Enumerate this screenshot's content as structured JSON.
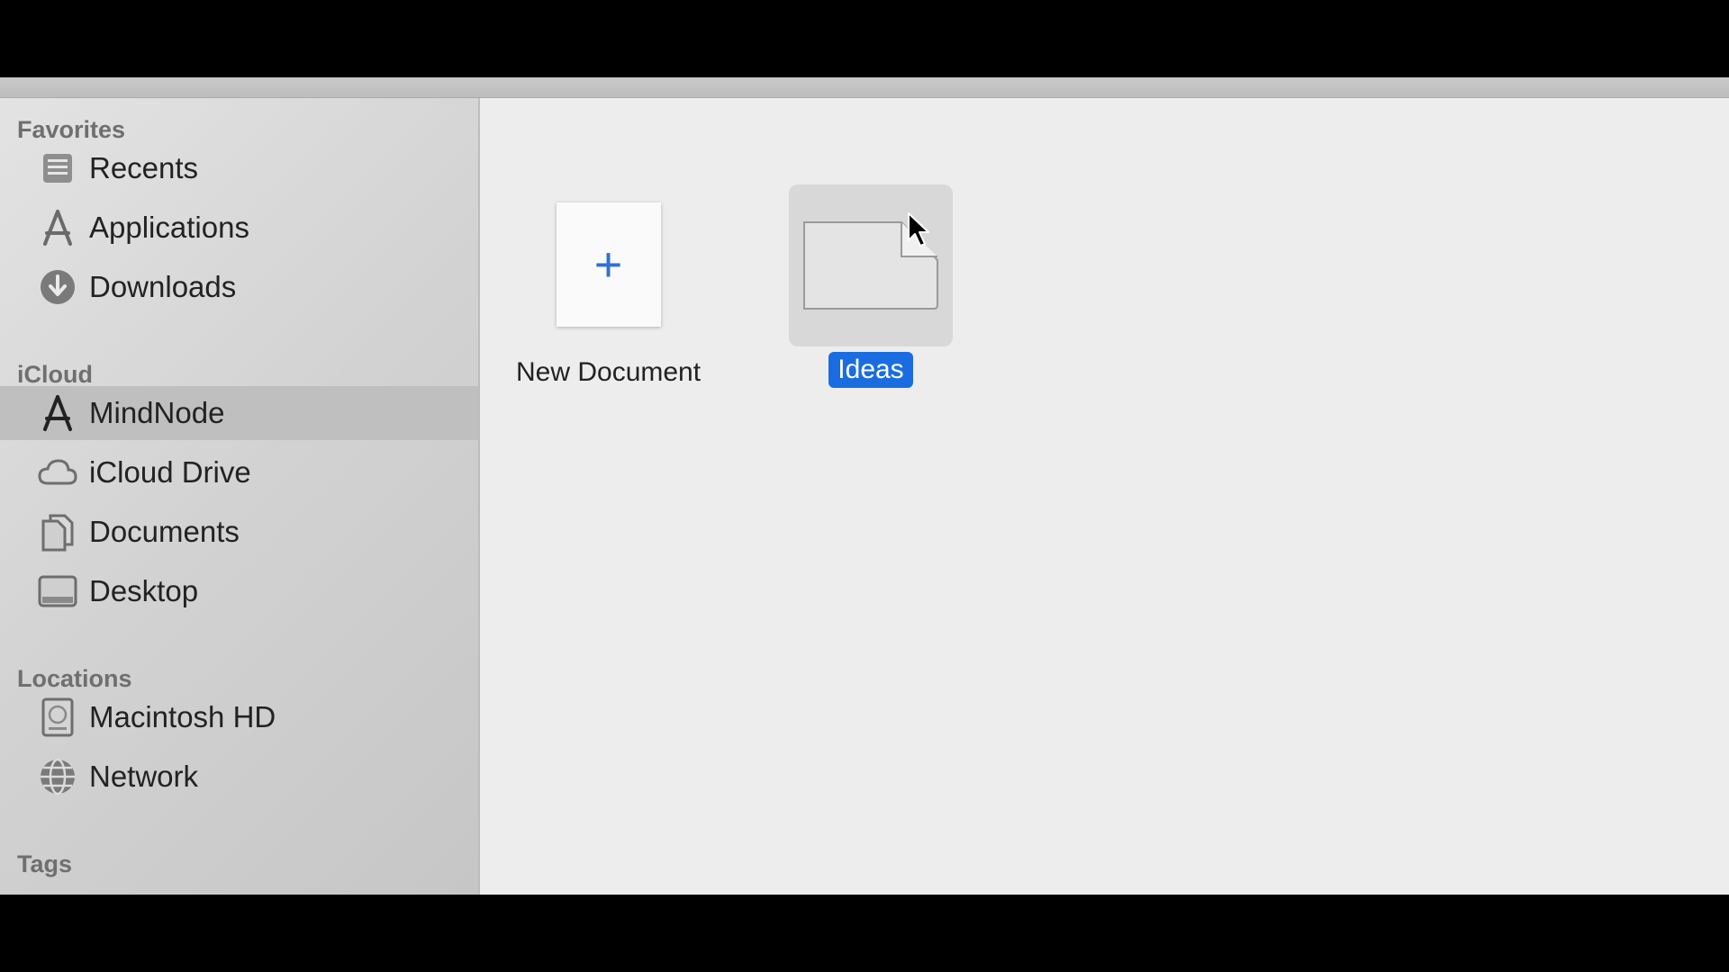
{
  "sidebar": {
    "sections": {
      "favorites": "Favorites",
      "icloud": "iCloud",
      "locations": "Locations",
      "tags": "Tags"
    },
    "items": [
      {
        "label": "Recents",
        "icon": "recents-icon"
      },
      {
        "label": "Applications",
        "icon": "applications-icon"
      },
      {
        "label": "Downloads",
        "icon": "downloads-icon"
      },
      {
        "label": "MindNode",
        "icon": "mindnode-icon",
        "selected": true
      },
      {
        "label": "iCloud Drive",
        "icon": "cloud-icon"
      },
      {
        "label": "Documents",
        "icon": "documents-icon"
      },
      {
        "label": "Desktop",
        "icon": "desktop-icon"
      },
      {
        "label": "Macintosh HD",
        "icon": "hard-drive-icon"
      },
      {
        "label": "Network",
        "icon": "network-icon"
      }
    ]
  },
  "content": {
    "new_document_label": "New Document",
    "ideas_label": "Ideas"
  },
  "colors": {
    "accent": "#1a6de0",
    "plus": "#2f6fd9"
  }
}
